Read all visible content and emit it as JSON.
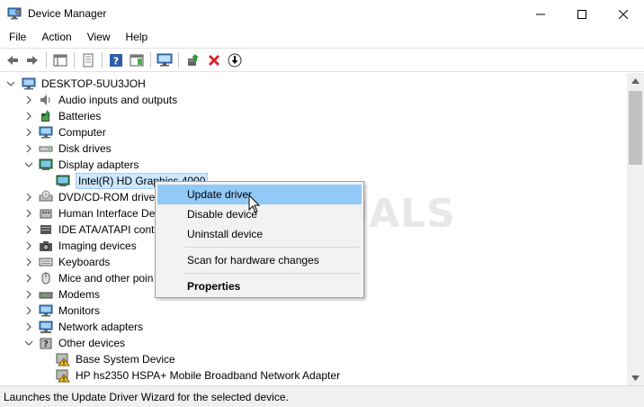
{
  "window": {
    "title": "Device Manager"
  },
  "menu": [
    "File",
    "Action",
    "View",
    "Help"
  ],
  "tree": {
    "root": "DESKTOP-5UU3JOH",
    "items": [
      {
        "label": "Audio inputs and outputs",
        "icon": "speaker-icon"
      },
      {
        "label": "Batteries",
        "icon": "battery-icon"
      },
      {
        "label": "Computer",
        "icon": "computer-icon"
      },
      {
        "label": "Disk drives",
        "icon": "disk-drive-icon"
      },
      {
        "label": "Display adapters",
        "icon": "display-adapter-icon"
      },
      {
        "label": "Intel(R) HD Graphics 4000",
        "icon": "display-adapter-icon"
      },
      {
        "label": "DVD/CD-ROM drives",
        "icon": "dvd-drive-icon"
      },
      {
        "label": "Human Interface Dev",
        "icon": "hid-icon"
      },
      {
        "label": "IDE ATA/ATAPI contr",
        "icon": "ide-controller-icon"
      },
      {
        "label": "Imaging devices",
        "icon": "camera-icon"
      },
      {
        "label": "Keyboards",
        "icon": "keyboard-icon"
      },
      {
        "label": "Mice and other poin",
        "icon": "mouse-icon"
      },
      {
        "label": "Modems",
        "icon": "modem-icon"
      },
      {
        "label": "Monitors",
        "icon": "monitor-icon"
      },
      {
        "label": "Network adapters",
        "icon": "network-adapter-icon"
      },
      {
        "label": "Other devices",
        "icon": "other-devices-icon"
      },
      {
        "label": "Base System Device",
        "icon": "warning-device-icon"
      },
      {
        "label": "HP hs2350 HSPA+ Mobile Broadband Network Adapter",
        "icon": "warning-device-icon"
      }
    ]
  },
  "context_menu": {
    "items": [
      "Update driver",
      "Disable device",
      "Uninstall device",
      "Scan for hardware changes",
      "Properties"
    ]
  },
  "status": {
    "text": "Launches the Update Driver Wizard for the selected device."
  },
  "watermark": "A PUALS",
  "colors": {
    "selection": "#cce8ff",
    "menu_highlight": "#91c9f7"
  }
}
